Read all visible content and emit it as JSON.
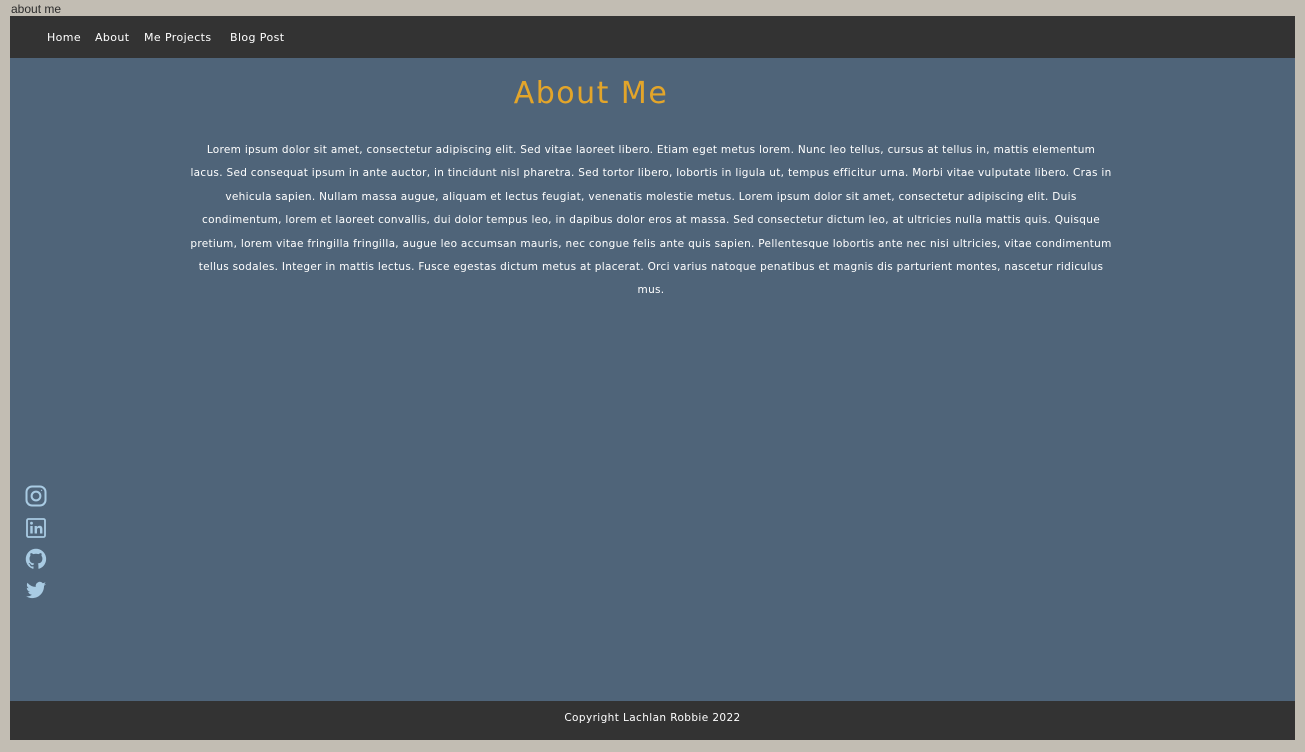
{
  "window": {
    "tab_caption": "about me"
  },
  "nav": {
    "items": [
      {
        "label": "Home"
      },
      {
        "label": "About"
      },
      {
        "label": "Me Projects"
      },
      {
        "label": "Blog Post"
      }
    ]
  },
  "main": {
    "title": "About Me",
    "intro": "Lorem ipsum dolor sit amet, consectetur adipiscing elit. Sed vitae laoreet libero. Etiam eget metus lorem. Nunc leo tellus, cursus at tellus in, mattis elementum lacus. Sed consequat ipsum in ante auctor, in tincidunt nisl pharetra. Sed tortor libero, lobortis in ligula ut, tempus efficitur urna. Morbi vitae vulputate libero. Cras in vehicula sapien. Nullam massa augue, aliquam et lectus feugiat, venenatis molestie metus. Lorem ipsum dolor sit amet, consectetur adipiscing elit. Duis condimentum, lorem et laoreet convallis, dui dolor tempus leo, in dapibus dolor eros at massa. Sed consectetur dictum leo, at ultricies nulla mattis quis. Quisque pretium, lorem vitae fringilla fringilla, augue leo accumsan mauris, nec congue felis ante quis sapien. Pellentesque lobortis ante nec nisi ultricies, vitae condimentum tellus sodales. Integer in mattis lectus. Fusce egestas dictum metus at placerat. Orci varius natoque penatibus et magnis dis parturient montes, nascetur ridiculus mus."
  },
  "social": {
    "icons": [
      "instagram-icon",
      "linkedin-icon",
      "github-icon",
      "twitter-icon"
    ],
    "icon_color": "#a9cbe3"
  },
  "footer": {
    "copyright": "Copyright Lachlan Robbie 2022"
  },
  "colors": {
    "page_background": "#c2bdb3",
    "content_background": "#4f6479",
    "bar_background": "#333333",
    "title": "#e3a52a",
    "text": "#ffffff"
  }
}
